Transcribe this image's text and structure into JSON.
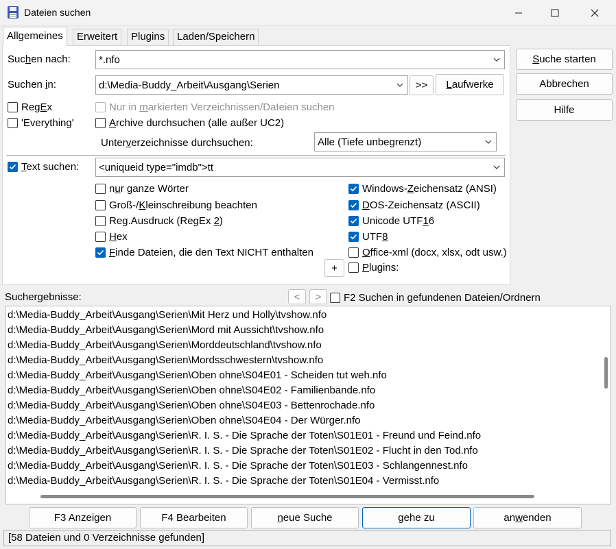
{
  "window": {
    "title": "Dateien suchen",
    "minimize": "—",
    "maximize": "☐",
    "close": "✕"
  },
  "tabs": [
    "Allgemeines",
    "Erweitert",
    "Plugins",
    "Laden/Speichern"
  ],
  "search": {
    "search_for_label": "Suchen nach:",
    "search_for_value": "*.nfo",
    "search_in_label": "Suchen in:",
    "search_in_value": "d:\\Media-Buddy_Arbeit\\Ausgang\\Serien",
    "browse_button": ">>",
    "drives_button": "Laufwerke"
  },
  "side_buttons": {
    "start": "Suche starten",
    "cancel": "Abbrechen",
    "help": "Hilfe"
  },
  "options": {
    "regex": "RegEx",
    "everything": "'Everything'",
    "marked_only": "Nur in markierten Verzeichnissen/Dateien suchen",
    "archives": "Archive durchsuchen (alle außer UC2)",
    "subdirs_label": "Unterverzeichnisse durchsuchen:",
    "subdirs_value": "Alle (Tiefe unbegrenzt)"
  },
  "text_search": {
    "label": "Text suchen:",
    "value": "<uniqueid type=\"imdb\">tt",
    "whole_words": "nur ganze Wörter",
    "case": "Groß-/Kleinschreibung beachten",
    "regex2": "Reg.Ausdruck (RegEx 2)",
    "hex": "Hex",
    "not_contain": "Finde Dateien, die den Text NICHT enthalten",
    "plus_button": "+",
    "windows_charset": "Windows-Zeichensatz (ANSI)",
    "dos_charset": "DOS-Zeichensatz (ASCII)",
    "unicode": "Unicode UTF16",
    "utf8": "UTF8",
    "office_xml": "Office-xml (docx, xlsx, odt usw.)",
    "plugins": "Plugins:"
  },
  "results": {
    "label": "Suchergebnisse:",
    "prev": "<",
    "next": ">",
    "f2_label": "F2 Suchen in gefundenen Dateien/Ordnern",
    "lines": [
      "d:\\Media-Buddy_Arbeit\\Ausgang\\Serien\\Mit Herz und Holly\\tvshow.nfo",
      "d:\\Media-Buddy_Arbeit\\Ausgang\\Serien\\Mord mit Aussicht\\tvshow.nfo",
      "d:\\Media-Buddy_Arbeit\\Ausgang\\Serien\\Morddeutschland\\tvshow.nfo",
      "d:\\Media-Buddy_Arbeit\\Ausgang\\Serien\\Mordsschwestern\\tvshow.nfo",
      "d:\\Media-Buddy_Arbeit\\Ausgang\\Serien\\Oben ohne\\S04E01 - Scheiden tut weh.nfo",
      "d:\\Media-Buddy_Arbeit\\Ausgang\\Serien\\Oben ohne\\S04E02 - Familienbande.nfo",
      "d:\\Media-Buddy_Arbeit\\Ausgang\\Serien\\Oben ohne\\S04E03 - Bettenrochade.nfo",
      "d:\\Media-Buddy_Arbeit\\Ausgang\\Serien\\Oben ohne\\S04E04 - Der Würger.nfo",
      "d:\\Media-Buddy_Arbeit\\Ausgang\\Serien\\R. I. S. - Die Sprache der Toten\\S01E01 - Freund und Feind.nfo",
      "d:\\Media-Buddy_Arbeit\\Ausgang\\Serien\\R. I. S. - Die Sprache der Toten\\S01E02 - Flucht in den Tod.nfo",
      "d:\\Media-Buddy_Arbeit\\Ausgang\\Serien\\R. I. S. - Die Sprache der Toten\\S01E03 - Schlangennest.nfo",
      "d:\\Media-Buddy_Arbeit\\Ausgang\\Serien\\R. I. S. - Die Sprache der Toten\\S01E04 - Vermisst.nfo"
    ]
  },
  "bottom_buttons": {
    "f3": "F3 Anzeigen",
    "f4": "F4 Bearbeiten",
    "new_search": "neue Suche",
    "goto": "gehe zu",
    "apply": "anwenden"
  },
  "status": "[58 Dateien und 0 Verzeichnisse gefunden]",
  "colors": {
    "accent": "#0067c0",
    "panel": "#ffffff",
    "window": "#f0f0f0"
  }
}
